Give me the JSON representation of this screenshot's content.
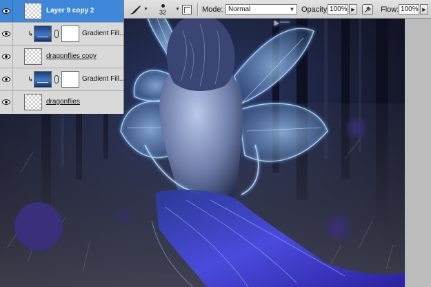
{
  "options_bar": {
    "tool_icon": "brush-icon",
    "brush_size": "32",
    "mode_label": "Mode:",
    "mode_value": "Normal",
    "opacity_label": "Opacity:",
    "opacity_value": "100%",
    "flow_label": "Flow:",
    "flow_value": "100%",
    "airbrush_icon": "airbrush-icon",
    "panel_toggle_icon": "brush-panel-toggle-icon"
  },
  "layers": [
    {
      "name": "Layer 9 copy 2",
      "selected": true,
      "thumb": "checker",
      "clipped": false,
      "mask": false
    },
    {
      "name": "Gradient Fill...",
      "selected": false,
      "thumb": "gradient",
      "clipped": true,
      "mask": true
    },
    {
      "name": "dragonflies copy",
      "selected": false,
      "thumb": "checker",
      "clipped": false,
      "mask": false
    },
    {
      "name": "Gradient Fill...",
      "selected": false,
      "thumb": "gradient",
      "clipped": true,
      "mask": true
    },
    {
      "name": "dragonflies",
      "selected": false,
      "thumb": "checker",
      "clipped": false,
      "mask": false
    }
  ],
  "colors": {
    "selection": "#3f87d8",
    "panel_bg": "#d9d9d9",
    "wings": "#8fc3ff",
    "dress": "#3b3fd4",
    "brush_blob": "#3a2f7a"
  },
  "canvas": {
    "description_icon": "fairy-artwork"
  }
}
